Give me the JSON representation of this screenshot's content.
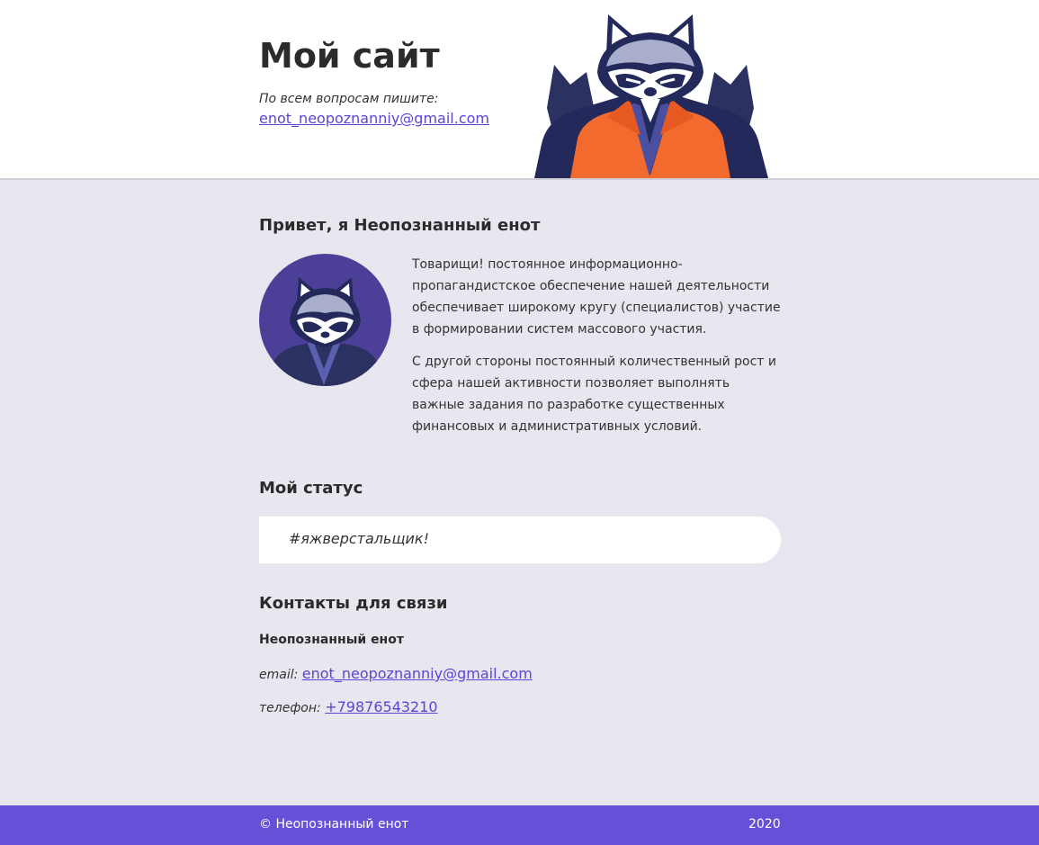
{
  "header": {
    "title": "Мой сайт",
    "note": "По всем вопросам пишите:",
    "email": "enot_neopoznanniy@gmail.com",
    "illustration": "raccoon-in-orange-jacket"
  },
  "about": {
    "title": "Привет, я Неопознанный енот",
    "avatar": "raccoon-avatar",
    "paragraphs": [
      "Товарищи! постоянное информационно-пропагандистское обеспечение нашей деятельности обеспечивает широкому кругу (специалистов) участие в формировании систем массового участия.",
      "С другой стороны постоянный количественный рост и сфера нашей активности позволяет выполнять важные задания по разработке существенных финансовых и административных условий."
    ]
  },
  "status": {
    "title": "Мой статус",
    "text": "#яжверстальщик!"
  },
  "contacts": {
    "title": "Контакты для связи",
    "name": "Неопознанный енот",
    "email_label": "email:",
    "email": "enot_neopoznanniy@gmail.com",
    "phone_label": "телефон:",
    "phone": "+79876543210"
  },
  "footer": {
    "copyright": "© Неопознанный енот",
    "year": "2020"
  },
  "colors": {
    "accent": "#6650d8",
    "link": "#5a45d4",
    "page_bg": "#e8e6ee",
    "jacket": "#f26a2e",
    "navy": "#232a55"
  }
}
